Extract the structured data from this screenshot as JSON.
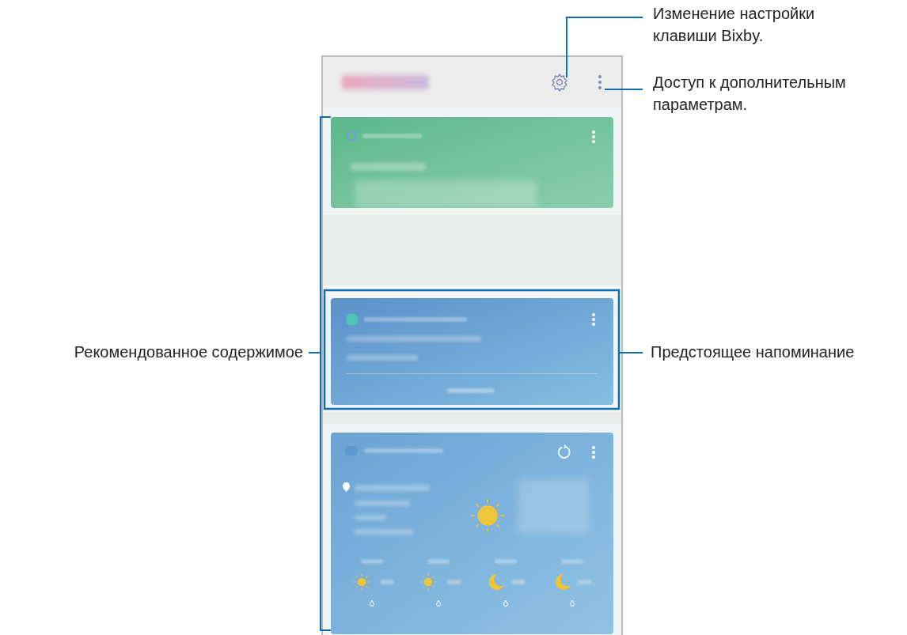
{
  "callouts": [
    {
      "kind": "settings",
      "text": "Изменение настройки клавиши Bixby."
    },
    {
      "kind": "more",
      "text": "Доступ к дополнительным параметрам."
    },
    {
      "kind": "bracket",
      "text": "Рекомендованное содержимое"
    },
    {
      "kind": "reminder",
      "text": "Предстоящее напоминание"
    }
  ],
  "forecast": [
    {
      "kind": "sun"
    },
    {
      "kind": "sun"
    },
    {
      "kind": "moon"
    },
    {
      "kind": "moon"
    }
  ]
}
